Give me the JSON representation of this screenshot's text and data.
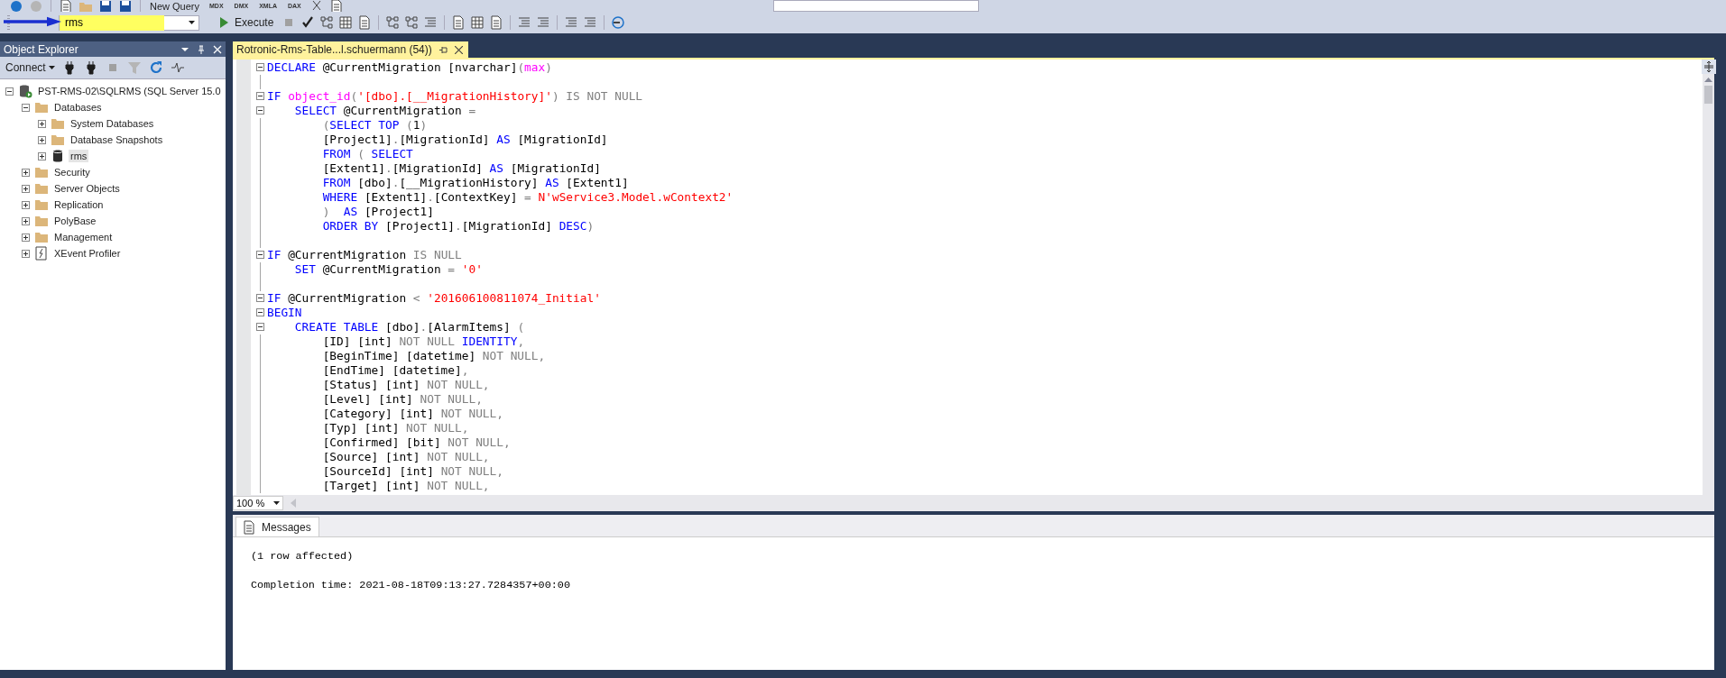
{
  "toolbar": {
    "new_query": "New Query",
    "query_types": [
      "MDX",
      "DMX",
      "XMLA",
      "DAX"
    ],
    "database": {
      "value": "rms"
    },
    "execute": "Execute"
  },
  "object_explorer": {
    "title": "Object Explorer",
    "connect": "Connect",
    "tree": [
      {
        "label": "PST-RMS-02\\SQLRMS (SQL Server 15.0",
        "kind": "server",
        "expanded": true,
        "selected": false,
        "children": [
          {
            "label": "Databases",
            "kind": "folder",
            "expanded": true,
            "selected": false,
            "children": [
              {
                "label": "System Databases",
                "kind": "folder",
                "expanded": false,
                "selected": false
              },
              {
                "label": "Database Snapshots",
                "kind": "folder",
                "expanded": false,
                "selected": false
              },
              {
                "label": "rms",
                "kind": "database",
                "expanded": false,
                "selected": true
              }
            ]
          },
          {
            "label": "Security",
            "kind": "folder",
            "expanded": false,
            "selected": false
          },
          {
            "label": "Server Objects",
            "kind": "folder",
            "expanded": false,
            "selected": false
          },
          {
            "label": "Replication",
            "kind": "folder",
            "expanded": false,
            "selected": false
          },
          {
            "label": "PolyBase",
            "kind": "folder",
            "expanded": false,
            "selected": false
          },
          {
            "label": "Management",
            "kind": "folder",
            "expanded": false,
            "selected": false
          },
          {
            "label": "XEvent Profiler",
            "kind": "xevent",
            "expanded": false,
            "selected": false
          }
        ]
      }
    ]
  },
  "editor": {
    "tab": {
      "title": "Rotronic-Rms-Table...l.schuermann (54))",
      "selected": true
    },
    "lines": [
      {
        "fold": true,
        "tokens": [
          {
            "kind": "keyword",
            "text": "DECLARE"
          },
          {
            "kind": "plain",
            "text": " @CurrentMigration [nvarchar]"
          },
          {
            "kind": "operator",
            "text": "("
          },
          {
            "kind": "function",
            "text": "max"
          },
          {
            "kind": "operator",
            "text": ")"
          }
        ]
      },
      {
        "fold": false
      },
      {
        "fold": true,
        "tokens": [
          {
            "kind": "keyword",
            "text": "IF"
          },
          {
            "kind": "function",
            "text": " object_id"
          },
          {
            "kind": "operator",
            "text": "("
          },
          {
            "kind": "string",
            "text": "'[dbo].[__MigrationHistory]'"
          },
          {
            "kind": "operator",
            "text": ") IS NOT NULL"
          }
        ]
      },
      {
        "fold": true,
        "tokens": [
          {
            "kind": "keyword",
            "text": "    SELECT"
          },
          {
            "kind": "plain",
            "text": " @CurrentMigration "
          },
          {
            "kind": "operator",
            "text": "="
          }
        ]
      },
      {
        "fold": false,
        "tokens": [
          {
            "kind": "operator",
            "text": "        ("
          },
          {
            "kind": "keyword",
            "text": "SELECT TOP"
          },
          {
            "kind": "operator",
            "text": " ("
          },
          {
            "kind": "plain",
            "text": "1"
          },
          {
            "kind": "operator",
            "text": ")"
          }
        ]
      },
      {
        "fold": false,
        "tokens": [
          {
            "kind": "plain",
            "text": "        [Project1]"
          },
          {
            "kind": "operator",
            "text": "."
          },
          {
            "kind": "plain",
            "text": "[MigrationId] "
          },
          {
            "kind": "keyword",
            "text": "AS"
          },
          {
            "kind": "plain",
            "text": " [MigrationId]"
          }
        ]
      },
      {
        "fold": false,
        "tokens": [
          {
            "kind": "keyword",
            "text": "        FROM"
          },
          {
            "kind": "operator",
            "text": " ( "
          },
          {
            "kind": "keyword",
            "text": "SELECT"
          }
        ]
      },
      {
        "fold": false,
        "tokens": [
          {
            "kind": "plain",
            "text": "        [Extent1]"
          },
          {
            "kind": "operator",
            "text": "."
          },
          {
            "kind": "plain",
            "text": "[MigrationId] "
          },
          {
            "kind": "keyword",
            "text": "AS"
          },
          {
            "kind": "plain",
            "text": " [MigrationId]"
          }
        ]
      },
      {
        "fold": false,
        "tokens": [
          {
            "kind": "keyword",
            "text": "        FROM"
          },
          {
            "kind": "plain",
            "text": " [dbo]"
          },
          {
            "kind": "operator",
            "text": "."
          },
          {
            "kind": "plain",
            "text": "[__MigrationHistory] "
          },
          {
            "kind": "keyword",
            "text": "AS"
          },
          {
            "kind": "plain",
            "text": " [Extent1]"
          }
        ]
      },
      {
        "fold": false,
        "tokens": [
          {
            "kind": "keyword",
            "text": "        WHERE"
          },
          {
            "kind": "plain",
            "text": " [Extent1]"
          },
          {
            "kind": "operator",
            "text": "."
          },
          {
            "kind": "plain",
            "text": "[ContextKey] "
          },
          {
            "kind": "operator",
            "text": "= "
          },
          {
            "kind": "string",
            "text": "N'wService3.Model.wContext2'"
          }
        ]
      },
      {
        "fold": false,
        "tokens": [
          {
            "kind": "operator",
            "text": "        )  "
          },
          {
            "kind": "keyword",
            "text": "AS"
          },
          {
            "kind": "plain",
            "text": " [Project1]"
          }
        ]
      },
      {
        "fold": false,
        "tokens": [
          {
            "kind": "keyword",
            "text": "        ORDER BY"
          },
          {
            "kind": "plain",
            "text": " [Project1]"
          },
          {
            "kind": "operator",
            "text": "."
          },
          {
            "kind": "plain",
            "text": "[MigrationId] "
          },
          {
            "kind": "keyword",
            "text": "DESC"
          },
          {
            "kind": "operator",
            "text": ")"
          }
        ]
      },
      {
        "fold": false
      },
      {
        "fold": true,
        "tokens": [
          {
            "kind": "keyword",
            "text": "IF"
          },
          {
            "kind": "plain",
            "text": " @CurrentMigration "
          },
          {
            "kind": "operator",
            "text": "IS NULL"
          }
        ]
      },
      {
        "fold": false,
        "tokens": [
          {
            "kind": "keyword",
            "text": "    SET"
          },
          {
            "kind": "plain",
            "text": " @CurrentMigration "
          },
          {
            "kind": "operator",
            "text": "= "
          },
          {
            "kind": "string",
            "text": "'0'"
          }
        ]
      },
      {
        "fold": false
      },
      {
        "fold": true,
        "tokens": [
          {
            "kind": "keyword",
            "text": "IF"
          },
          {
            "kind": "plain",
            "text": " @CurrentMigration "
          },
          {
            "kind": "operator",
            "text": "< "
          },
          {
            "kind": "string",
            "text": "'201606100811074_Initial'"
          }
        ]
      },
      {
        "fold": true,
        "tokens": [
          {
            "kind": "keyword",
            "text": "BEGIN"
          }
        ]
      },
      {
        "fold": true,
        "tokens": [
          {
            "kind": "keyword",
            "text": "    CREATE TABLE"
          },
          {
            "kind": "plain",
            "text": " [dbo]"
          },
          {
            "kind": "operator",
            "text": "."
          },
          {
            "kind": "plain",
            "text": "[AlarmItems] "
          },
          {
            "kind": "operator",
            "text": "("
          }
        ]
      },
      {
        "fold": false,
        "tokens": [
          {
            "kind": "plain",
            "text": "        [ID] [int] "
          },
          {
            "kind": "operator",
            "text": "NOT NULL "
          },
          {
            "kind": "keyword",
            "text": "IDENTITY"
          },
          {
            "kind": "operator",
            "text": ","
          }
        ]
      },
      {
        "fold": false,
        "tokens": [
          {
            "kind": "plain",
            "text": "        [BeginTime] [datetime] "
          },
          {
            "kind": "operator",
            "text": "NOT NULL,"
          }
        ]
      },
      {
        "fold": false,
        "tokens": [
          {
            "kind": "plain",
            "text": "        [EndTime] [datetime]"
          },
          {
            "kind": "operator",
            "text": ","
          }
        ]
      },
      {
        "fold": false,
        "tokens": [
          {
            "kind": "plain",
            "text": "        [Status] [int] "
          },
          {
            "kind": "operator",
            "text": "NOT NULL,"
          }
        ]
      },
      {
        "fold": false,
        "tokens": [
          {
            "kind": "plain",
            "text": "        [Level] [int] "
          },
          {
            "kind": "operator",
            "text": "NOT NULL,"
          }
        ]
      },
      {
        "fold": false,
        "tokens": [
          {
            "kind": "plain",
            "text": "        [Category] [int] "
          },
          {
            "kind": "operator",
            "text": "NOT NULL,"
          }
        ]
      },
      {
        "fold": false,
        "tokens": [
          {
            "kind": "plain",
            "text": "        [Typ] [int] "
          },
          {
            "kind": "operator",
            "text": "NOT NULL,"
          }
        ]
      },
      {
        "fold": false,
        "tokens": [
          {
            "kind": "plain",
            "text": "        [Confirmed] [bit] "
          },
          {
            "kind": "operator",
            "text": "NOT NULL,"
          }
        ]
      },
      {
        "fold": false,
        "tokens": [
          {
            "kind": "plain",
            "text": "        [Source] [int] "
          },
          {
            "kind": "operator",
            "text": "NOT NULL,"
          }
        ]
      },
      {
        "fold": false,
        "tokens": [
          {
            "kind": "plain",
            "text": "        [SourceId] [int] "
          },
          {
            "kind": "operator",
            "text": "NOT NULL,"
          }
        ]
      },
      {
        "fold": false,
        "tokens": [
          {
            "kind": "plain",
            "text": "        [Target] [int] "
          },
          {
            "kind": "operator",
            "text": "NOT NULL,"
          }
        ]
      }
    ],
    "zoom": "100 %"
  },
  "results": {
    "tabs": [
      {
        "label": "Messages",
        "selected": true
      }
    ],
    "messages": [
      "(1 row affected)",
      "Completion time: 2021-08-18T09:13:27.7284357+00:00"
    ]
  }
}
